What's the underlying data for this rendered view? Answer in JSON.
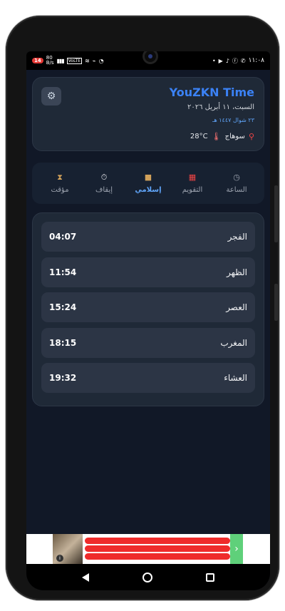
{
  "status_bar": {
    "battery_badge": "14",
    "net_speed_top": "80",
    "net_speed_bottom": "B/s",
    "volte": "VoLTE",
    "time": "١١:٠٨"
  },
  "header": {
    "title": "YouZKN Time",
    "gregorian_date": "السبت، ١١ أبريل ٢٠٢٦",
    "hijri_date": "٢٣ شوال ١٤٤٧ هـ",
    "city": "سوهاج",
    "temperature": "28°C",
    "icons": {
      "settings": "gear-icon",
      "location": "pin-icon",
      "weather": "thermometer-icon"
    }
  },
  "tabs": [
    {
      "label": "الساعة",
      "icon": "clock-icon",
      "active": false
    },
    {
      "label": "التقويم",
      "icon": "calendar-icon",
      "active": false
    },
    {
      "label": "إسلامي",
      "icon": "kaaba-icon",
      "active": true
    },
    {
      "label": "إيقاف",
      "icon": "stopwatch-icon",
      "active": false
    },
    {
      "label": "مؤقت",
      "icon": "hourglass-icon",
      "active": false
    }
  ],
  "prayers": [
    {
      "name": "الفجر",
      "time": "04:07"
    },
    {
      "name": "الظهر",
      "time": "11:54"
    },
    {
      "name": "العصر",
      "time": "15:24"
    },
    {
      "name": "المغرب",
      "time": "18:15"
    },
    {
      "name": "العشاء",
      "time": "19:32"
    }
  ],
  "colors": {
    "accent": "#3b82f6",
    "background": "#111827",
    "card": "#1f2937",
    "row": "#2c3545"
  }
}
